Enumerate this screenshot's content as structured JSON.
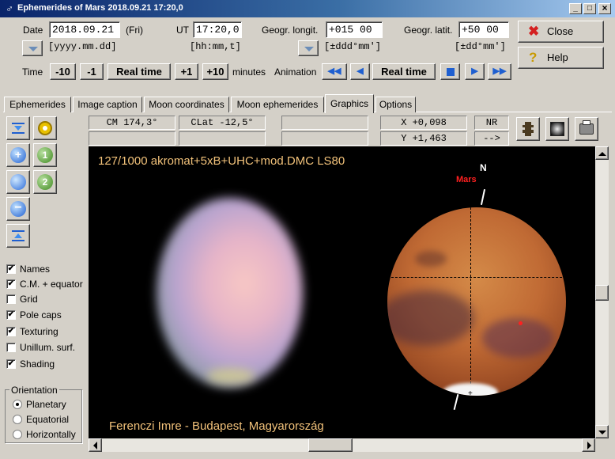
{
  "window": {
    "title": "Ephemerides of Mars  2018.09.21  17:20,0",
    "minimize": "_",
    "maximize": "□",
    "close": "×"
  },
  "date": {
    "label": "Date",
    "value": "2018.09.21",
    "weekday": "(Fri)",
    "format": "[yyyy.mm.dd]"
  },
  "ut": {
    "label": "UT",
    "value": "17:20,0",
    "format": "[hh:mm,t]"
  },
  "longitude": {
    "label": "Geogr. longit.",
    "value": "+015 00",
    "format": "[±ddd°mm']"
  },
  "latitude": {
    "label": "Geogr. latit.",
    "value": "+50 00",
    "format": "[±dd°mm']"
  },
  "buttons": {
    "close": "Close",
    "help": "Help"
  },
  "time_row": {
    "label": "Time",
    "minus10": "-10",
    "minus1": "-1",
    "realtime": "Real time",
    "plus1": "+1",
    "plus10": "+10",
    "unit": "minutes"
  },
  "animation": {
    "label": "Animation",
    "realtime": "Real time"
  },
  "tabs": [
    "Ephemerides",
    "Image caption",
    "Moon coordinates",
    "Moon ephemerides",
    "Graphics",
    "Options"
  ],
  "active_tab": "Graphics",
  "readouts": {
    "cm": "CM   174,3°",
    "clat": "CLat  -12,5°",
    "x": "X   +0,098",
    "y": "Y   +1,463",
    "nr": "NR",
    "arrow": "-->"
  },
  "options": [
    {
      "label": "Names",
      "checked": true
    },
    {
      "label": "C.M. + equator",
      "checked": true
    },
    {
      "label": "Grid",
      "checked": false
    },
    {
      "label": "Pole caps",
      "checked": true
    },
    {
      "label": "Texturing",
      "checked": true
    },
    {
      "label": "Unillum. surf.",
      "checked": false
    },
    {
      "label": "Shading",
      "checked": true
    }
  ],
  "orientation": {
    "title": "Orientation",
    "choices": [
      "Planetary",
      "Equatorial",
      "Horizontally"
    ],
    "selected": "Planetary"
  },
  "view": {
    "caption_top": "127/1000 akromat+5xB+UHC+mod.DMC LS80",
    "caption_bottom": "Ferenczi Imre - Budapest, Magyarország",
    "north": "N",
    "planet": "Mars"
  },
  "colors": {
    "caption": "#f2c27a",
    "planet_label": "#ff2020",
    "titlebar": "#0a246a"
  }
}
